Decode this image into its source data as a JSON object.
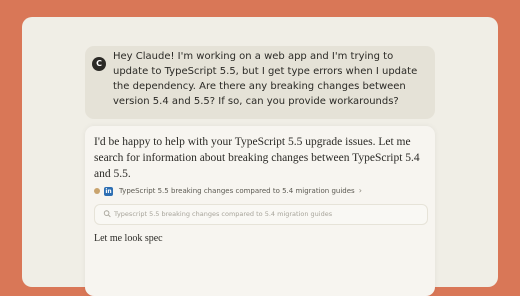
{
  "chat": {
    "user_message": {
      "avatar_initial": "C",
      "text": "Hey Claude! I'm working on a web app and I'm trying to update to TypeScript 5.5, but I get type errors when I update the dependency. Are there any breaking changes between version 5.4 and 5.5? If so, can you provide workarounds?"
    },
    "assistant": {
      "intro": "I'd be happy to help with your TypeScript 5.5 upgrade issues. Let me search for information about breaking changes between TypeScript 5.4 and 5.5.",
      "search_result": {
        "icons": [
          "site-favicon",
          "linkedin-icon"
        ],
        "label": "TypeScript 5.5 breaking changes compared to 5.4 migration guides"
      },
      "search_query": "Typescript 5.5 breaking changes compared to 5.4 migration guides",
      "streaming_text": "Let me look spec"
    }
  },
  "colors": {
    "background": "#d97757",
    "window": "#f0eee6",
    "user_bubble": "#e5e2d7",
    "assistant_card": "#f7f5f0"
  }
}
